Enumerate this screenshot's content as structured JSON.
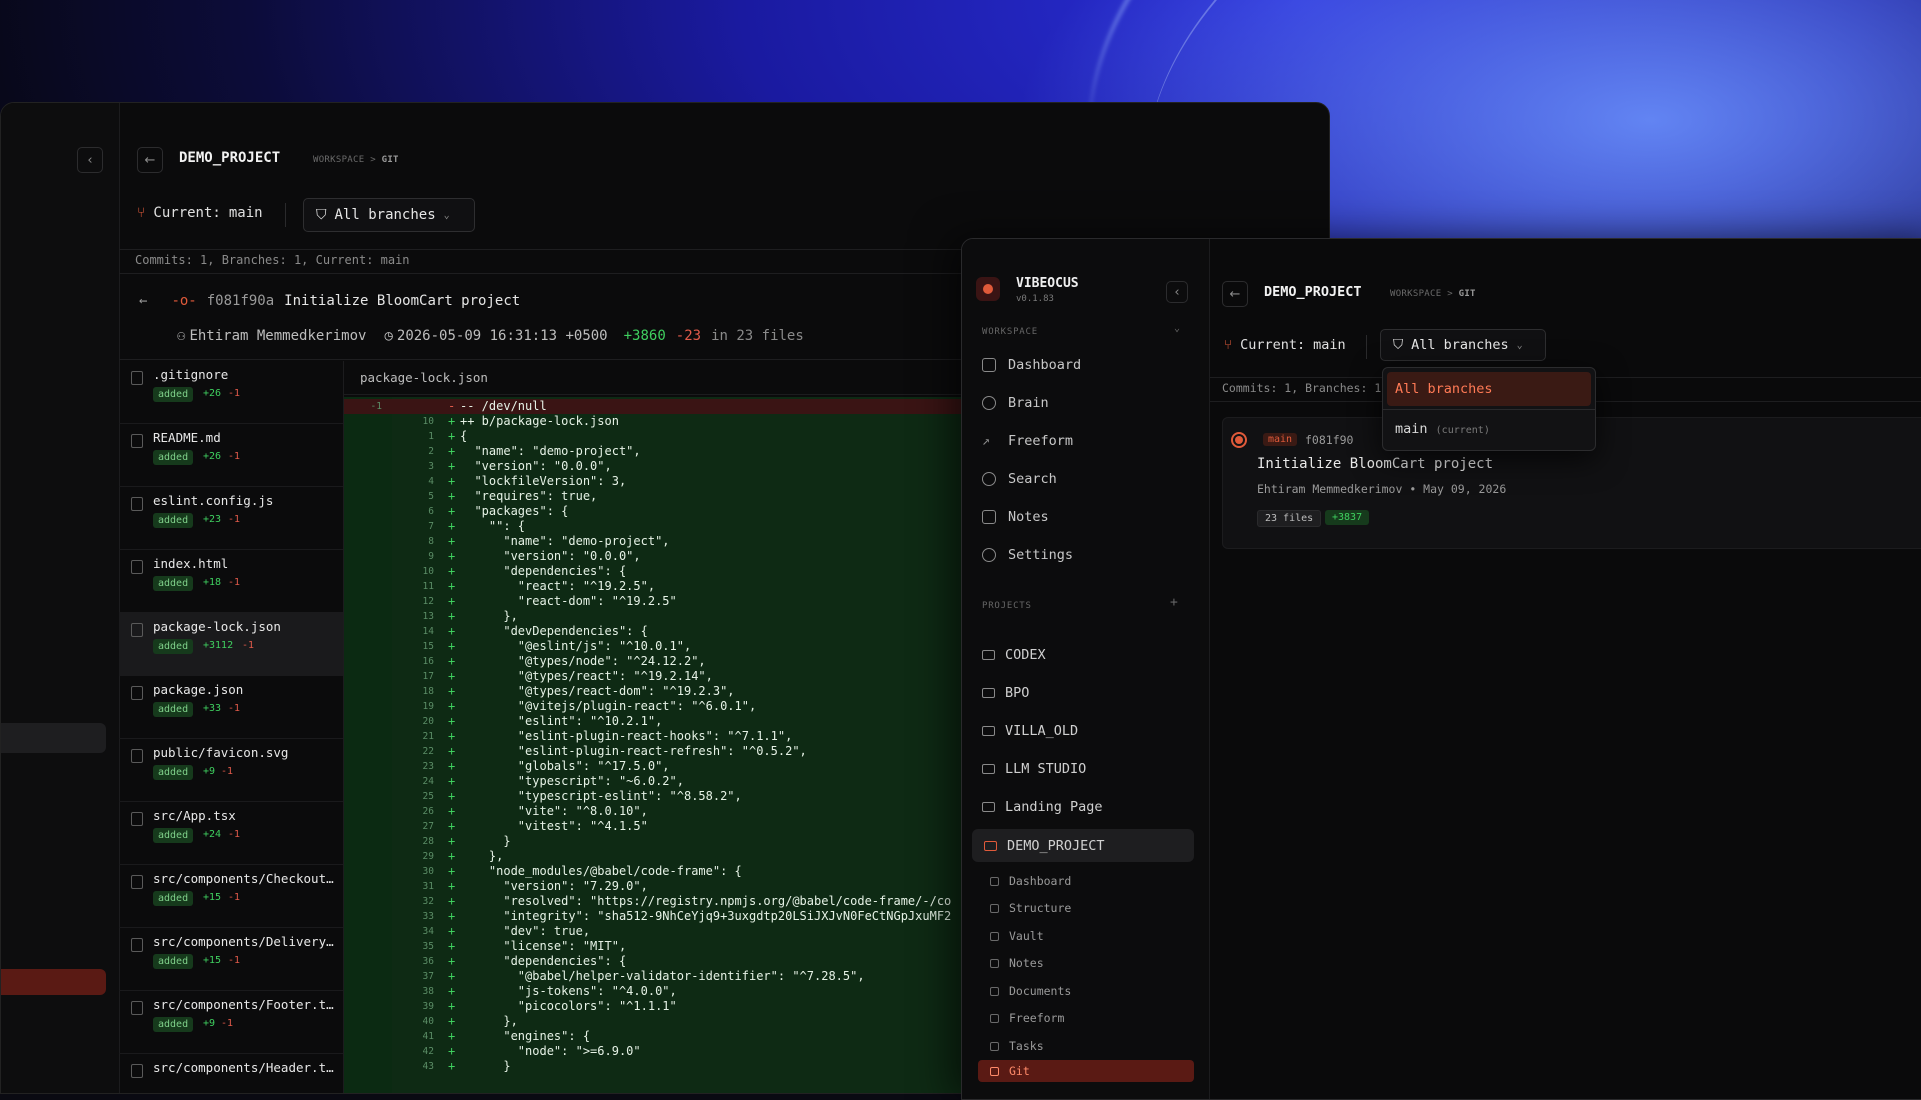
{
  "back": {
    "project_title": "DEMO_PROJECT",
    "crumb_workspace": "WORKSPACE",
    "crumb_sep": ">",
    "crumb_git": "GIT",
    "current_label": "Current:",
    "current_branch": "main",
    "branches_button": "All branches",
    "stats": "Commits: 1, Branches: 1, Current: main",
    "commit_hash": "f081f90a",
    "commit_title": "Initialize BloomCart project",
    "author": "Ehtiram Memmedkerimov",
    "date": "2026-05-09 16:31:13 +0500",
    "additions": "+3860",
    "deletions": "-23",
    "files_suffix": "in 23 files",
    "diff_file": "package-lock.json",
    "files": [
      {
        "name": ".gitignore",
        "badge": "added",
        "adds": "+26",
        "dels": "-1"
      },
      {
        "name": "README.md",
        "badge": "added",
        "adds": "+26",
        "dels": "-1"
      },
      {
        "name": "eslint.config.js",
        "badge": "added",
        "adds": "+23",
        "dels": "-1"
      },
      {
        "name": "index.html",
        "badge": "added",
        "adds": "+18",
        "dels": "-1"
      },
      {
        "name": "package-lock.json",
        "badge": "added",
        "adds": "+3112",
        "dels": "-1"
      },
      {
        "name": "package.json",
        "badge": "added",
        "adds": "+33",
        "dels": "-1"
      },
      {
        "name": "public/favicon.svg",
        "badge": "added",
        "adds": "+9",
        "dels": "-1"
      },
      {
        "name": "src/App.tsx",
        "badge": "added",
        "adds": "+24",
        "dels": "-1"
      },
      {
        "name": "src/components/Checkout…",
        "badge": "added",
        "adds": "+15",
        "dels": "-1"
      },
      {
        "name": "src/components/Delivery…",
        "badge": "added",
        "adds": "+15",
        "dels": "-1"
      },
      {
        "name": "src/components/Footer.t…",
        "badge": "added",
        "adds": "+9",
        "dels": "-1"
      },
      {
        "name": "src/components/Header.t…",
        "badge": "",
        "adds": "",
        "dels": ""
      }
    ],
    "diff_lines": [
      {
        "n1": "-1",
        "n2": "",
        "sign": "-",
        "text": "-- /dev/null",
        "del": true
      },
      {
        "n1": "",
        "n2": "10",
        "sign": "+",
        "text": "++ b/package-lock.json"
      },
      {
        "n1": "",
        "n2": "1",
        "sign": "+",
        "text": "{"
      },
      {
        "n1": "",
        "n2": "2",
        "sign": "+",
        "text": "  \"name\": \"demo-project\","
      },
      {
        "n1": "",
        "n2": "3",
        "sign": "+",
        "text": "  \"version\": \"0.0.0\","
      },
      {
        "n1": "",
        "n2": "4",
        "sign": "+",
        "text": "  \"lockfileVersion\": 3,"
      },
      {
        "n1": "",
        "n2": "5",
        "sign": "+",
        "text": "  \"requires\": true,"
      },
      {
        "n1": "",
        "n2": "6",
        "sign": "+",
        "text": "  \"packages\": {"
      },
      {
        "n1": "",
        "n2": "7",
        "sign": "+",
        "text": "    \"\": {"
      },
      {
        "n1": "",
        "n2": "8",
        "sign": "+",
        "text": "      \"name\": \"demo-project\","
      },
      {
        "n1": "",
        "n2": "9",
        "sign": "+",
        "text": "      \"version\": \"0.0.0\","
      },
      {
        "n1": "",
        "n2": "10",
        "sign": "+",
        "text": "      \"dependencies\": {"
      },
      {
        "n1": "",
        "n2": "11",
        "sign": "+",
        "text": "        \"react\": \"^19.2.5\","
      },
      {
        "n1": "",
        "n2": "12",
        "sign": "+",
        "text": "        \"react-dom\": \"^19.2.5\""
      },
      {
        "n1": "",
        "n2": "13",
        "sign": "+",
        "text": "      },"
      },
      {
        "n1": "",
        "n2": "14",
        "sign": "+",
        "text": "      \"devDependencies\": {"
      },
      {
        "n1": "",
        "n2": "15",
        "sign": "+",
        "text": "        \"@eslint/js\": \"^10.0.1\","
      },
      {
        "n1": "",
        "n2": "16",
        "sign": "+",
        "text": "        \"@types/node\": \"^24.12.2\","
      },
      {
        "n1": "",
        "n2": "17",
        "sign": "+",
        "text": "        \"@types/react\": \"^19.2.14\","
      },
      {
        "n1": "",
        "n2": "18",
        "sign": "+",
        "text": "        \"@types/react-dom\": \"^19.2.3\","
      },
      {
        "n1": "",
        "n2": "19",
        "sign": "+",
        "text": "        \"@vitejs/plugin-react\": \"^6.0.1\","
      },
      {
        "n1": "",
        "n2": "20",
        "sign": "+",
        "text": "        \"eslint\": \"^10.2.1\","
      },
      {
        "n1": "",
        "n2": "21",
        "sign": "+",
        "text": "        \"eslint-plugin-react-hooks\": \"^7.1.1\","
      },
      {
        "n1": "",
        "n2": "22",
        "sign": "+",
        "text": "        \"eslint-plugin-react-refresh\": \"^0.5.2\","
      },
      {
        "n1": "",
        "n2": "23",
        "sign": "+",
        "text": "        \"globals\": \"^17.5.0\","
      },
      {
        "n1": "",
        "n2": "24",
        "sign": "+",
        "text": "        \"typescript\": \"~6.0.2\","
      },
      {
        "n1": "",
        "n2": "25",
        "sign": "+",
        "text": "        \"typescript-eslint\": \"^8.58.2\","
      },
      {
        "n1": "",
        "n2": "26",
        "sign": "+",
        "text": "        \"vite\": \"^8.0.10\","
      },
      {
        "n1": "",
        "n2": "27",
        "sign": "+",
        "text": "        \"vitest\": \"^4.1.5\""
      },
      {
        "n1": "",
        "n2": "28",
        "sign": "+",
        "text": "      }"
      },
      {
        "n1": "",
        "n2": "29",
        "sign": "+",
        "text": "    },"
      },
      {
        "n1": "",
        "n2": "30",
        "sign": "+",
        "text": "    \"node_modules/@babel/code-frame\": {"
      },
      {
        "n1": "",
        "n2": "31",
        "sign": "+",
        "text": "      \"version\": \"7.29.0\","
      },
      {
        "n1": "",
        "n2": "32",
        "sign": "+",
        "text": "      \"resolved\": \"https://registry.npmjs.org/@babel/code-frame/-/co"
      },
      {
        "n1": "",
        "n2": "33",
        "sign": "+",
        "text": "      \"integrity\": \"sha512-9NhCeYjq9+3uxgdtp20LSiJXJvN0FeCtNGpJxuMF2"
      },
      {
        "n1": "",
        "n2": "34",
        "sign": "+",
        "text": "      \"dev\": true,"
      },
      {
        "n1": "",
        "n2": "35",
        "sign": "+",
        "text": "      \"license\": \"MIT\","
      },
      {
        "n1": "",
        "n2": "36",
        "sign": "+",
        "text": "      \"dependencies\": {"
      },
      {
        "n1": "",
        "n2": "37",
        "sign": "+",
        "text": "        \"@babel/helper-validator-identifier\": \"^7.28.5\","
      },
      {
        "n1": "",
        "n2": "38",
        "sign": "+",
        "text": "        \"js-tokens\": \"^4.0.0\","
      },
      {
        "n1": "",
        "n2": "39",
        "sign": "+",
        "text": "        \"picocolors\": \"^1.1.1\""
      },
      {
        "n1": "",
        "n2": "40",
        "sign": "+",
        "text": "      },"
      },
      {
        "n1": "",
        "n2": "41",
        "sign": "+",
        "text": "      \"engines\": {"
      },
      {
        "n1": "",
        "n2": "42",
        "sign": "+",
        "text": "        \"node\": \">=6.9.0\""
      },
      {
        "n1": "",
        "n2": "43",
        "sign": "+",
        "text": "      }"
      }
    ]
  },
  "front": {
    "app_name": "VIBEOCUS",
    "app_version": "v0.1.83",
    "workspace_label": "WORKSPACE",
    "nav": [
      {
        "label": "Dashboard",
        "icon": "dashboard-icon"
      },
      {
        "label": "Brain",
        "icon": "brain-icon"
      },
      {
        "label": "Freeform",
        "icon": "pen-icon"
      },
      {
        "label": "Search",
        "icon": "search-icon"
      },
      {
        "label": "Notes",
        "icon": "notes-icon"
      },
      {
        "label": "Settings",
        "icon": "gear-icon"
      }
    ],
    "projects_label": "PROJECTS",
    "projects": [
      "CODEX",
      "BPO",
      "VILLA_OLD",
      "LLM STUDIO",
      "Landing Page",
      "DEMO_PROJECT"
    ],
    "subitems": [
      "Dashboard",
      "Structure",
      "Vault",
      "Notes",
      "Documents",
      "Freeform",
      "Tasks",
      "Git"
    ],
    "project_title": "DEMO_PROJECT",
    "crumb_workspace": "WORKSPACE",
    "crumb_sep": ">",
    "crumb_git": "GIT",
    "current_label": "Current:",
    "current_branch": "main",
    "branches_button": "All branches",
    "stats": "Commits: 1, Branches: 1",
    "dropdown": {
      "all": "All branches",
      "main": "main",
      "main_note": "(current)"
    },
    "commit": {
      "tag": "main",
      "hash": "f081f90",
      "title": "Initialize BloomCart project",
      "meta": "Ehtiram Memmedkerimov • May 09, 2026",
      "files": "23 files",
      "adds": "+3837"
    }
  },
  "colors": {
    "accent": "#e05a3a",
    "add": "#3fcf5f",
    "del": "#e05a4a"
  }
}
